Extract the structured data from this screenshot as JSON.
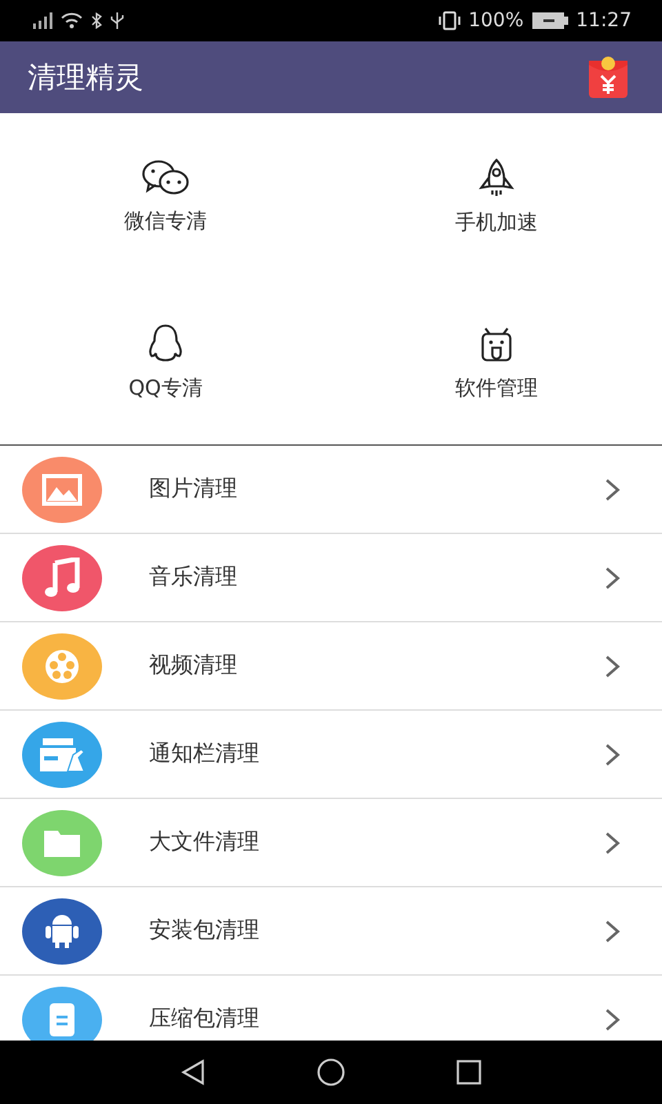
{
  "status_bar": {
    "battery_text": "100%",
    "time": "11:27"
  },
  "app_bar": {
    "title": "清理精灵"
  },
  "shortcuts": [
    {
      "kind": "chat",
      "label": "微信专清"
    },
    {
      "kind": "rocket",
      "label": "手机加速"
    },
    {
      "kind": "penguin",
      "label": "QQ专清"
    },
    {
      "kind": "robot",
      "label": "软件管理"
    }
  ],
  "items": [
    {
      "kind": "image",
      "label": "图片清理",
      "color": "#f98b6a"
    },
    {
      "kind": "music",
      "label": "音乐清理",
      "color": "#f0566a"
    },
    {
      "kind": "film",
      "label": "视频清理",
      "color": "#f8b443"
    },
    {
      "kind": "notify",
      "label": "通知栏清理",
      "color": "#35a6e8"
    },
    {
      "kind": "folder",
      "label": "大文件清理",
      "color": "#7ed56e"
    },
    {
      "kind": "android",
      "label": "安装包清理",
      "color": "#2d5fb5"
    },
    {
      "kind": "doc",
      "label": "压缩包清理",
      "color": "#4ab0f0"
    }
  ]
}
